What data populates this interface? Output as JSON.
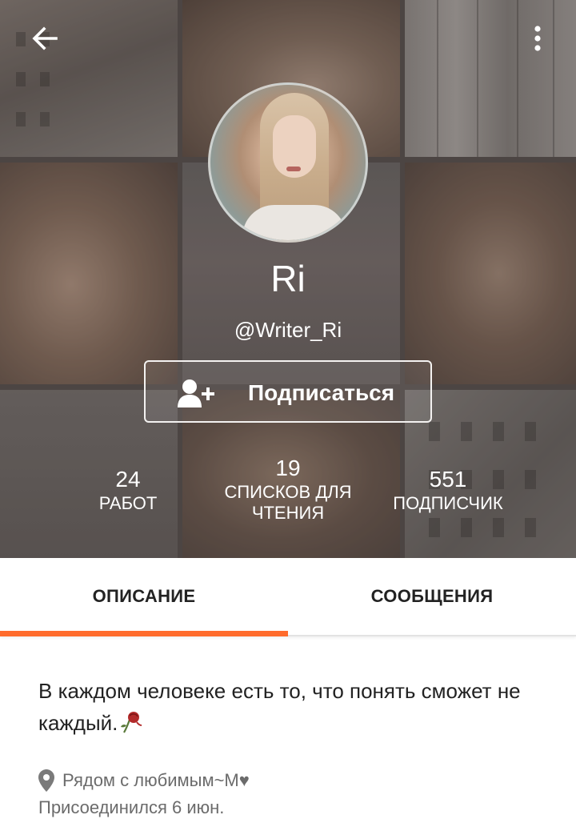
{
  "topbar": {
    "back_icon": "arrow-left-icon",
    "more_icon": "more-vertical-icon"
  },
  "profile": {
    "display_name": "Ri",
    "username": "@Writer_Ri",
    "follow_label": "Подписаться",
    "follow_icon": "add-user-icon"
  },
  "stats": {
    "works_count": "24",
    "works_label": "РАБОТ",
    "lists_count": "19",
    "lists_label_line1": "СПИСКОВ ДЛЯ",
    "lists_label_line2": "ЧТЕНИЯ",
    "followers_count": "551",
    "followers_label": "ПОДПИСЧИК"
  },
  "tabs": {
    "description_label": "ОПИСАНИЕ",
    "messages_label": "СООБЩЕНИЯ",
    "active": "description"
  },
  "about": {
    "bio": "В каждом человеке есть то, что понять сможет не каждый.",
    "bio_emoji": "wilted-rose-icon",
    "location": "Рядом с любимым~M♥",
    "location_icon": "location-pin-icon",
    "joined": "Присоединился 6 июн."
  },
  "colors": {
    "accent": "#ff6b2c",
    "text_primary": "#222222",
    "text_secondary": "#6b6b6b"
  }
}
